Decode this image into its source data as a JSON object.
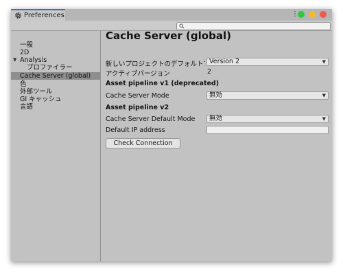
{
  "window": {
    "tab_title": "Preferences",
    "search": {
      "placeholder": "",
      "value": ""
    },
    "traffic_lights": {
      "green": "#2fc840",
      "yellow": "#f5b92f",
      "red": "#f0584f"
    }
  },
  "sidebar": {
    "items": [
      {
        "label": "一般"
      },
      {
        "label": "2D"
      },
      {
        "label": "Analysis",
        "expanded": true
      },
      {
        "label": "プロファイラー"
      },
      {
        "label": "Cache Server (global)",
        "selected": true
      },
      {
        "label": "色"
      },
      {
        "label": "外部ツール"
      },
      {
        "label": "GI キャッシュ"
      },
      {
        "label": "言語"
      }
    ]
  },
  "content": {
    "title": "Cache Server (global)",
    "default_version_label": "新しいプロジェクトのデフォルトアセット",
    "default_version_value": "Version 2",
    "active_version_label": "アクティブバージョン",
    "active_version_value": "2",
    "v1_section": "Asset pipeline v1 (deprecated)",
    "cache_mode_label": "Cache Server Mode",
    "cache_mode_value": "無効",
    "v2_section": "Asset pipeline v2",
    "default_mode_label": "Cache Server Default Mode",
    "default_mode_value": "無効",
    "ip_label": "Default IP address",
    "ip_value": "",
    "check_button": "Check Connection"
  }
}
